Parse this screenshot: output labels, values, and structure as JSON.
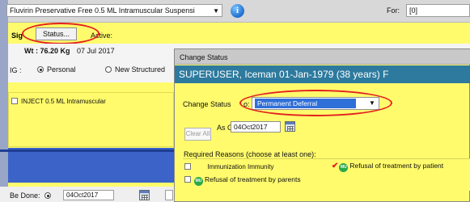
{
  "top_bar": {
    "medication_value": "Fluvirin Preservative Free 0.5 ML Intramuscular Suspensi",
    "for_label": "For:",
    "for_value": "[0]"
  },
  "order": {
    "sig_label": "Sig",
    "status_button": "Status...",
    "active_label": "Active:",
    "weight": "Wt : 76.20 Kg",
    "weight_date": "07 Jul 2017",
    "sig_type_label": "IG :",
    "radio_personal": "Personal",
    "radio_new_structured": "New Structured",
    "sig_item": "INJECT 0.5  ML Intramuscular",
    "be_done_label": "Be Done:",
    "be_done_date": "04Oct2017"
  },
  "dialog": {
    "title": "Change Status",
    "patient": "SUPERUSER, Iceman  01-Jan-1979  (38 years)  F",
    "change_status_label": "Change Status",
    "to_label": "o:",
    "change_status_value": "Permanent Deferral",
    "clear_all": "Clear All",
    "as_of_label": "As Of:",
    "as_of_value": "04Oct2017",
    "required_reasons_label": "Required Reasons (choose at least one):",
    "reasons": [
      {
        "label": "Immunization Immunity",
        "checked": false,
        "badge": ""
      },
      {
        "label": "Refusal of treatment by patient",
        "checked": true,
        "badge": "MU"
      },
      {
        "label": "Refusal of treatment by parents",
        "checked": false,
        "badge": "MU"
      }
    ]
  },
  "colors": {
    "highlight_yellow": "#fffb6c",
    "annotation_red": "#e32020",
    "patient_band": "#2d7a9e",
    "selection_blue": "#2f6fd8"
  },
  "icons": [
    "info-icon",
    "calendar-icon",
    "dropdown-caret-icon",
    "mu-badge-icon",
    "checkmark-icon"
  ]
}
